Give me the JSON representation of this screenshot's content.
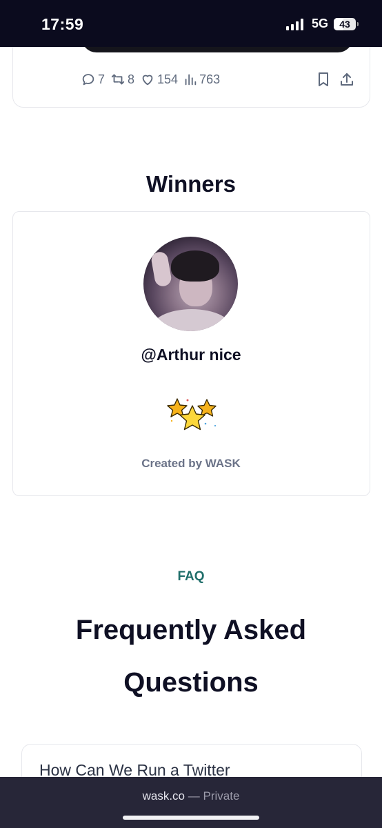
{
  "status_bar": {
    "time": "17:59",
    "network": "5G",
    "battery": "43",
    "battery_level_percent": 43
  },
  "tweet": {
    "replies": "7",
    "retweets": "8",
    "likes": "154",
    "views": "763",
    "icons": [
      "reply-icon",
      "retweet-icon",
      "like-icon",
      "views-icon",
      "bookmark-icon",
      "share-icon"
    ]
  },
  "winners": {
    "title": "Winners",
    "handle": "@Arthur nice",
    "created_by": "Created by WASK",
    "badge_icon": "stars-icon"
  },
  "faq": {
    "label": "FAQ",
    "title_line1": "Frequently Asked",
    "title_line2": "Questions",
    "first_question": "How Can We Run a Twitter"
  },
  "browser": {
    "domain": "wask.co",
    "separator": "—",
    "mode": "Private"
  },
  "colors": {
    "status_bar_bg": "#0b0b1e",
    "heading": "#0f1024",
    "faq_accent": "#1f6e6a",
    "muted": "#6b7388",
    "browser_bar_bg": "#272638"
  }
}
